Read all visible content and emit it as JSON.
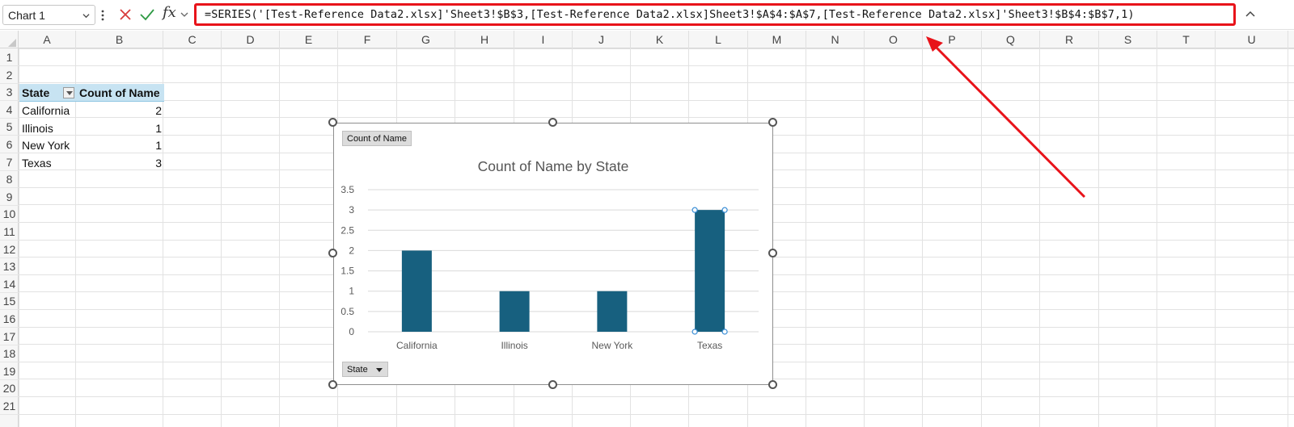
{
  "formula_bar": {
    "name_box": "Chart 1",
    "fx_label": "fx",
    "formula": "=SERIES('[Test-Reference Data2.xlsx]'Sheet3!$B$3,[Test-Reference Data2.xlsx]Sheet3!$A$4:$A$7,[Test-Reference Data2.xlsx]'Sheet3!$B$4:$B$7,1)"
  },
  "grid": {
    "columns": [
      "A",
      "B",
      "C",
      "D",
      "E",
      "F",
      "G",
      "H",
      "I",
      "J",
      "K",
      "L",
      "M",
      "N",
      "O",
      "P",
      "Q",
      "R",
      "S",
      "T",
      "U"
    ],
    "rows": [
      "1",
      "2",
      "3",
      "4",
      "5",
      "6",
      "7",
      "8",
      "9",
      "10",
      "11",
      "12",
      "13",
      "14",
      "15",
      "16",
      "17",
      "18",
      "19",
      "20",
      "21"
    ]
  },
  "pivot_table": {
    "headers": [
      "State",
      "Count of Name"
    ],
    "rows": [
      {
        "label": "California",
        "value": "2"
      },
      {
        "label": "Illinois",
        "value": "1"
      },
      {
        "label": "New York",
        "value": "1"
      },
      {
        "label": "Texas",
        "value": "3"
      }
    ]
  },
  "chart": {
    "value_field_button": "Count  of Name",
    "axis_field_button": "State",
    "selected_category": "Texas"
  },
  "chart_data": {
    "type": "bar",
    "title": "Count of Name by State",
    "categories": [
      "California",
      "Illinois",
      "New York",
      "Texas"
    ],
    "values": [
      2,
      1,
      1,
      3
    ],
    "ylim": [
      0,
      3.5
    ],
    "yticks": [
      "0",
      "0.5",
      "1",
      "1.5",
      "2",
      "2.5",
      "3",
      "3.5"
    ],
    "grid": true,
    "bar_color": "#17607f",
    "gridline_color": "#d9d9d9"
  },
  "colors": {
    "annotation": "#e8131a",
    "pivot_header": "#c7e3f2"
  }
}
